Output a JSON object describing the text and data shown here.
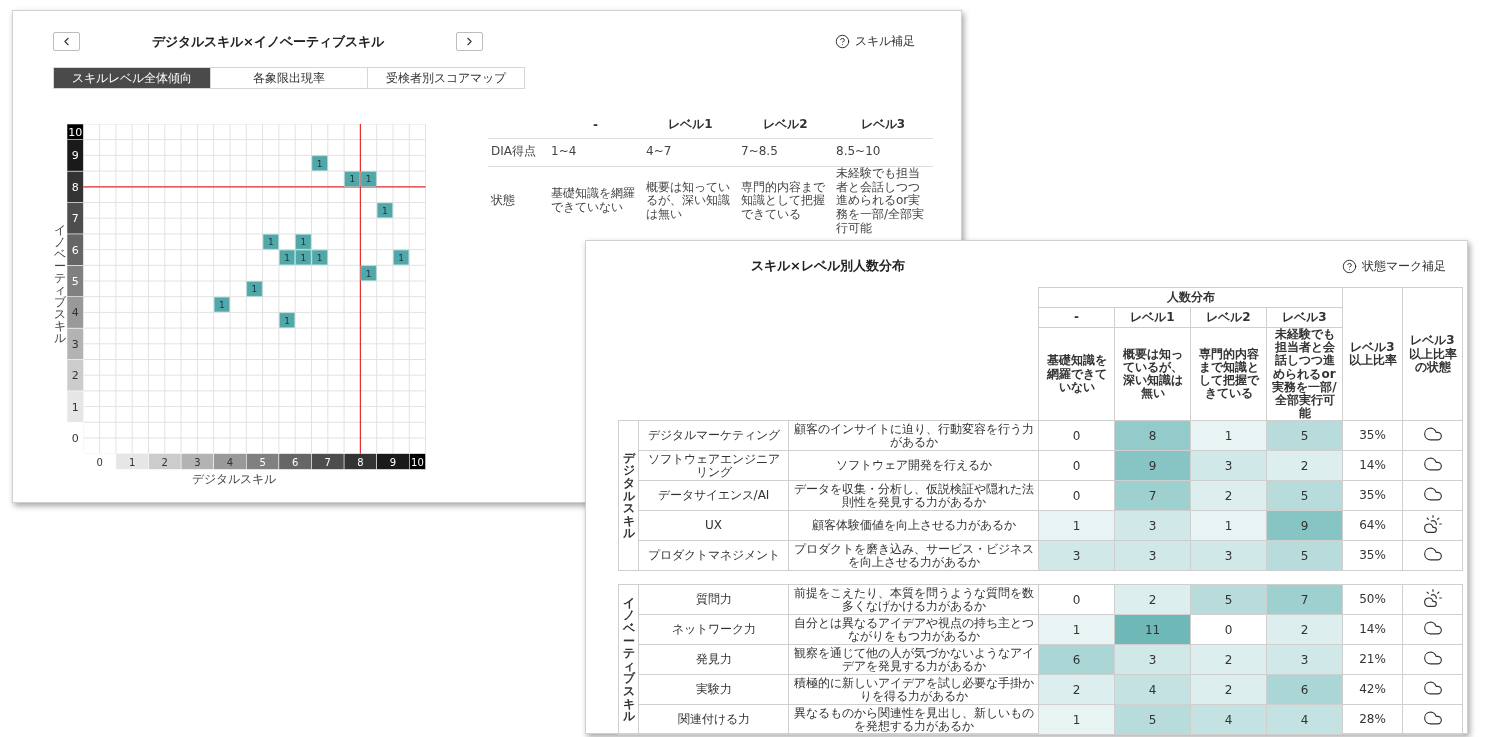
{
  "back_window": {
    "title": "デジタルスキル×イノベーティブスキル",
    "help_link": "スキル補足",
    "tabs": [
      {
        "label": "スキルレベル全体傾向",
        "selected": true
      },
      {
        "label": "各象限出現率",
        "selected": false
      },
      {
        "label": "受検者別スコアマップ",
        "selected": false
      }
    ],
    "chart": {
      "chart_data": {
        "type": "scatter",
        "xlabel": "デジタルスキル",
        "ylabel": "イノベーティブスキル",
        "x": [
          7.25,
          8.25,
          8.75,
          9.25,
          5.75,
          6.75,
          6.25,
          6.75,
          7.25,
          9.75,
          8.75,
          5.25,
          4.25,
          6.25
        ],
        "series": [
          {
            "color": "#52a8a8",
            "values": [
              9.25,
              8.75,
              8.75,
              7.75,
              6.75,
              6.75,
              6.25,
              6.25,
              6.25,
              6.25,
              5.75,
              5.25,
              4.75,
              4.25
            ]
          }
        ],
        "value_labels": [
          "1",
          "1",
          "1",
          "1",
          "1",
          "1",
          "1",
          "1",
          "1",
          "1",
          "1",
          "1",
          "1",
          "1"
        ],
        "xlim": [
          0,
          10.5
        ],
        "ylim": [
          0,
          10.5
        ],
        "xticks": [
          {
            "value": 0.5,
            "label": "0"
          },
          {
            "value": 1.5,
            "label": "1"
          },
          {
            "value": 2.5,
            "label": "2"
          },
          {
            "value": 3.5,
            "label": "3"
          },
          {
            "value": 4.5,
            "label": "4"
          },
          {
            "value": 5.5,
            "label": "5"
          },
          {
            "value": 6.5,
            "label": "6"
          },
          {
            "value": 7.5,
            "label": "7"
          },
          {
            "value": 8.5,
            "label": "8"
          },
          {
            "value": 9.5,
            "label": "9"
          },
          {
            "value": 10.25,
            "label": "10"
          }
        ],
        "yticks": [
          {
            "value": 0.5,
            "label": "0"
          },
          {
            "value": 1.5,
            "label": "1"
          },
          {
            "value": 2.5,
            "label": "2"
          },
          {
            "value": 3.5,
            "label": "3"
          },
          {
            "value": 4.5,
            "label": "4"
          },
          {
            "value": 5.5,
            "label": "5"
          },
          {
            "value": 6.5,
            "label": "6"
          },
          {
            "value": 7.5,
            "label": "7"
          },
          {
            "value": 8.5,
            "label": "8"
          },
          {
            "value": 9.5,
            "label": "9"
          },
          {
            "value": 10.25,
            "label": "10"
          }
        ],
        "grid": true
      }
    },
    "level_table": {
      "columns": [
        "-",
        "レベル1",
        "レベル2",
        "レベル3"
      ],
      "rows": [
        {
          "label": "DIA得点",
          "cells": [
            "1~4",
            "4~7",
            "7~8.5",
            "8.5~10"
          ]
        },
        {
          "label": "状態",
          "cells": [
            "基礎知識を網羅できていない",
            "概要は知っているが、深い知識は無い",
            "専門的内容まで知識として把握できている",
            "未経験でも担当者と会話しつつ進められるor実務を一部/全部実行可能"
          ]
        }
      ]
    }
  },
  "front_window": {
    "title": "スキル×レベル別人数分布",
    "help_link": "状態マーク補足",
    "table": {
      "group_header": "人数分布",
      "ratio_header": "レベル3以上比率",
      "status_header": "レベル3以上比率の状態",
      "levels": [
        {
          "label": "-",
          "description": "基礎知識を網羅できていない"
        },
        {
          "label": "レベル1",
          "description": "概要は知っているが、深い知識は無い"
        },
        {
          "label": "レベル2",
          "description": "専門的内容まで知識として把握できている"
        },
        {
          "label": "レベル3",
          "description": "未経験でも担当者と会話しつつ進められるor実務を一部/全部実行可能"
        }
      ],
      "sections": [
        {
          "label": "デジタルスキル",
          "rows": [
            {
              "name": "デジタルマーケティング",
              "description": "顧客のインサイトに迫り、行動変容を行う力があるか",
              "counts": [
                "0",
                "8",
                "1",
                "5"
              ],
              "ratio": "35%",
              "kind": "cloudy"
            },
            {
              "name": "ソフトウェアエンジニアリング",
              "description": "ソフトウェア開発を行えるか",
              "counts": [
                "0",
                "9",
                "3",
                "2"
              ],
              "ratio": "14%",
              "kind": "cloudy"
            },
            {
              "name": "データサイエンス/AI",
              "description": "データを収集・分析し、仮説検証や隠れた法則性を発見する力があるか",
              "counts": [
                "0",
                "7",
                "2",
                "5"
              ],
              "ratio": "35%",
              "kind": "cloudy"
            },
            {
              "name": "UX",
              "description": "顧客体験価値を向上させる力があるか",
              "counts": [
                "1",
                "3",
                "1",
                "9"
              ],
              "ratio": "64%",
              "kind": "partly_sunny"
            },
            {
              "name": "プロダクトマネジメント",
              "description": "プロダクトを磨き込み、サービス・ビジネスを向上させる力があるか",
              "counts": [
                "3",
                "3",
                "3",
                "5"
              ],
              "ratio": "35%",
              "kind": "cloudy"
            }
          ]
        },
        {
          "label": "イノベーティブスキル",
          "rows": [
            {
              "name": "質問力",
              "description": "前提をこえたり、本質を問うような質問を数多くなげかける力があるか",
              "counts": [
                "0",
                "2",
                "5",
                "7"
              ],
              "ratio": "50%",
              "kind": "partly_sunny"
            },
            {
              "name": "ネットワーク力",
              "description": "自分とは異なるアイデアや視点の持ち主とつながりをもつ力があるか",
              "counts": [
                "1",
                "11",
                "0",
                "2"
              ],
              "ratio": "14%",
              "kind": "cloudy"
            },
            {
              "name": "発見力",
              "description": "観察を通じて他の人が気づかないようなアイデアを発見する力があるか",
              "counts": [
                "6",
                "3",
                "2",
                "3"
              ],
              "ratio": "21%",
              "kind": "cloudy"
            },
            {
              "name": "実験力",
              "description": "積極的に新しいアイデアを試し必要な手掛かりを得る力があるか",
              "counts": [
                "2",
                "4",
                "2",
                "6"
              ],
              "ratio": "42%",
              "kind": "cloudy"
            },
            {
              "name": "関連付ける力",
              "description": "異なるものから関連性を見出し、新しいものを発想する力があるか",
              "counts": [
                "1",
                "5",
                "4",
                "4"
              ],
              "ratio": "28%",
              "kind": "cloudy"
            }
          ]
        }
      ]
    }
  }
}
